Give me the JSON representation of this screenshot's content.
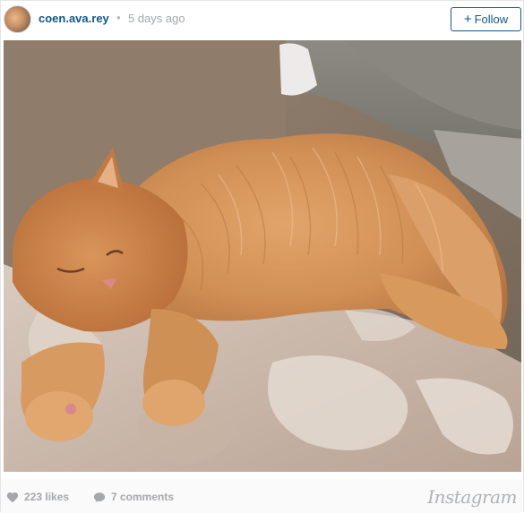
{
  "header": {
    "username": "coen.ava.rey",
    "separator": "•",
    "time_ago": "5 days ago",
    "follow_label": "Follow",
    "follow_icon": "+"
  },
  "photo": {
    "subject": "sleeping-ginger-cat-photo"
  },
  "footer": {
    "likes": "223 likes",
    "comments": "7 comments",
    "logo_text": "Instagram"
  },
  "colors": {
    "link_blue": "#125688",
    "muted_gray": "#a5a7aa",
    "footer_bg": "#fafafa"
  }
}
